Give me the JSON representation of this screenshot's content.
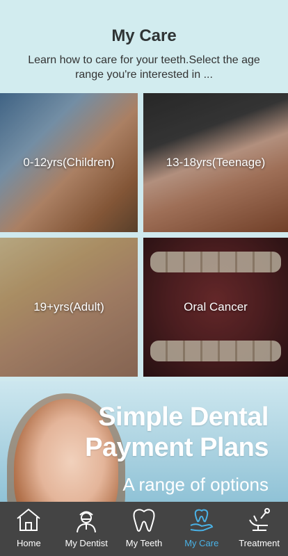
{
  "header": {
    "title": "My Care",
    "subtitle": "Learn how to care for your teeth.Select the age range you're interested in ..."
  },
  "tiles": [
    {
      "label": "0-12yrs(Children)"
    },
    {
      "label": "13-18yrs(Teenage)"
    },
    {
      "label": "19+yrs(Adult)"
    },
    {
      "label": "Oral Cancer"
    }
  ],
  "banner": {
    "headline_line1": "Simple Dental",
    "headline_line2": "Payment Plans",
    "sub_line1": "A range of options"
  },
  "tabbar": {
    "items": [
      {
        "label": "Home",
        "icon": "home-icon"
      },
      {
        "label": "My Dentist",
        "icon": "dentist-icon"
      },
      {
        "label": "My Teeth",
        "icon": "tooth-icon"
      },
      {
        "label": "My Care",
        "icon": "care-hand-tooth-icon",
        "active": true
      },
      {
        "label": "Treatment",
        "icon": "dental-chair-icon"
      }
    ],
    "active_color": "#4ab2e6",
    "background": "#444444"
  }
}
